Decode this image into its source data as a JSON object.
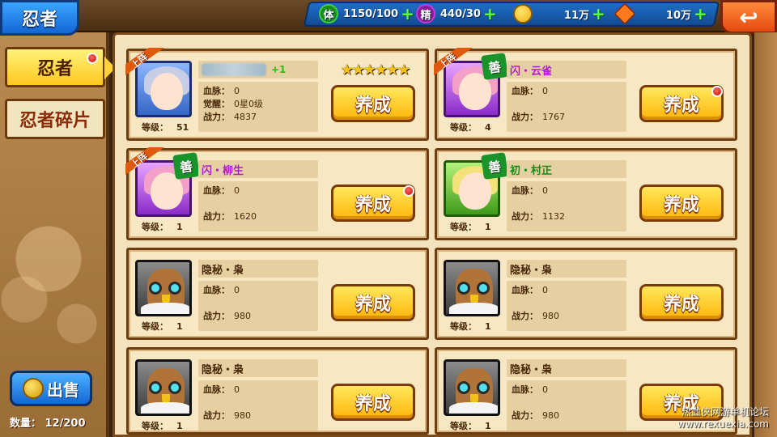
{
  "header": {
    "title": "忍者",
    "resources": [
      {
        "icon": "stamina-icon",
        "glyph": "体",
        "value": "1150/100",
        "color": "#3ad23a"
      },
      {
        "icon": "spirit-icon",
        "glyph": "精",
        "value": "440/30",
        "color": "#c83ad2"
      },
      {
        "icon": "coin-icon",
        "glyph": "",
        "value": "11万",
        "color": "#f0b21a"
      },
      {
        "icon": "gem-icon",
        "glyph": "",
        "value": "10万",
        "color": "#ff7a1a"
      }
    ],
    "back_label": "↩"
  },
  "sidebar": {
    "tabs": [
      {
        "label": "忍者",
        "active": true,
        "has_alert": true
      },
      {
        "label": "忍者碎片",
        "active": false,
        "has_alert": false
      }
    ],
    "sell_label": "出售",
    "count_label": "数量：",
    "count_value": "12/200"
  },
  "labels": {
    "bloodline": "血脉：",
    "awaken": "觉醒：",
    "power": "战力：",
    "level": "等级：",
    "train": "养成",
    "deployed": "上阵",
    "shan": "善"
  },
  "ninjas": [
    {
      "name": "",
      "name_blurred": true,
      "plus": "+1",
      "rarity": "blue",
      "deployed": true,
      "shan": false,
      "bloodline": "0",
      "awaken": "0星0级",
      "power": "4837",
      "level": "51",
      "stars": 6,
      "alert": false
    },
    {
      "name": "闪・云雀",
      "name_blurred": false,
      "plus": "",
      "rarity": "purple",
      "deployed": true,
      "shan": true,
      "bloodline": "0",
      "awaken": "",
      "power": "1767",
      "level": "4",
      "stars": 0,
      "alert": true
    },
    {
      "name": "闪・柳生",
      "name_blurred": false,
      "plus": "",
      "rarity": "purple",
      "deployed": true,
      "shan": true,
      "bloodline": "0",
      "awaken": "",
      "power": "1620",
      "level": "1",
      "stars": 0,
      "alert": true
    },
    {
      "name": "初・村正",
      "name_blurred": false,
      "plus": "",
      "rarity": "green",
      "deployed": false,
      "shan": true,
      "bloodline": "0",
      "awaken": "",
      "power": "1132",
      "level": "1",
      "stars": 0,
      "alert": false
    },
    {
      "name": "隐秘・枭",
      "name_blurred": false,
      "plus": "",
      "rarity": "grey",
      "deployed": false,
      "shan": false,
      "bloodline": "0",
      "awaken": "",
      "power": "980",
      "level": "1",
      "stars": 0,
      "alert": false
    },
    {
      "name": "隐秘・枭",
      "name_blurred": false,
      "plus": "",
      "rarity": "grey",
      "deployed": false,
      "shan": false,
      "bloodline": "0",
      "awaken": "",
      "power": "980",
      "level": "1",
      "stars": 0,
      "alert": false
    },
    {
      "name": "隐秘・枭",
      "name_blurred": false,
      "plus": "",
      "rarity": "grey",
      "deployed": false,
      "shan": false,
      "bloodline": "0",
      "awaken": "",
      "power": "980",
      "level": "1",
      "stars": 0,
      "alert": false
    },
    {
      "name": "隐秘・枭",
      "name_blurred": false,
      "plus": "",
      "rarity": "grey",
      "deployed": false,
      "shan": false,
      "bloodline": "0",
      "awaken": "",
      "power": "980",
      "level": "1",
      "stars": 0,
      "alert": false
    }
  ],
  "watermark": {
    "line1": "热血侠网游单机论坛",
    "line2": "www.rexuexia.com"
  }
}
